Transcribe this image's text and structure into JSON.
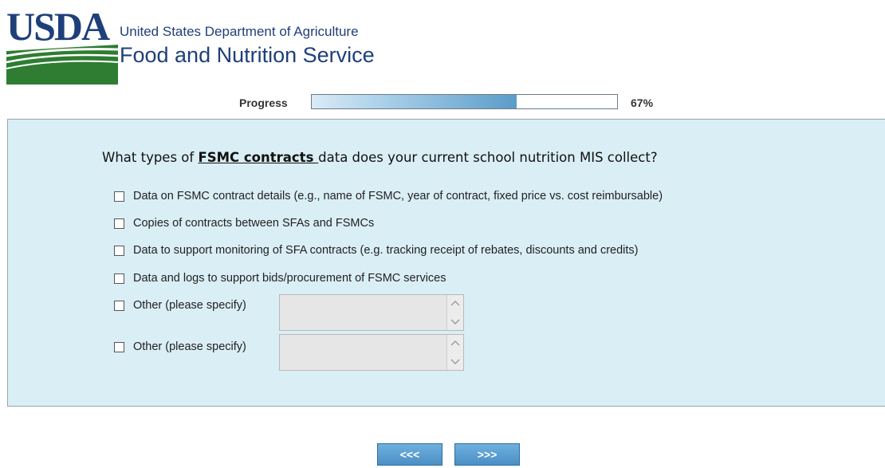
{
  "header": {
    "logo_text": "USDA",
    "agency_line1": "United States Department of Agriculture",
    "agency_line2": "Food and Nutrition Service"
  },
  "progress": {
    "label": "Progress",
    "percent_text": "67%",
    "value": 0.67
  },
  "question": {
    "prefix": "What types of ",
    "keyword": "FSMC contracts ",
    "suffix": "data does your current school nutrition MIS collect?"
  },
  "options": [
    {
      "label": "Data on FSMC contract details (e.g., name of FSMC, year of contract, fixed price vs. cost reimbursable)",
      "checked": false
    },
    {
      "label": "Copies of contracts between SFAs and FSMCs",
      "checked": false
    },
    {
      "label": "Data to support monitoring of SFA contracts (e.g. tracking receipt of rebates, discounts and credits)",
      "checked": false
    },
    {
      "label": "Data and logs to support bids/procurement of FSMC services",
      "checked": false
    },
    {
      "label": "Other (please specify)",
      "checked": false,
      "text_value": ""
    },
    {
      "label": "Other (please specify)",
      "checked": false,
      "text_value": ""
    }
  ],
  "nav": {
    "back_label": "<<<",
    "next_label": ">>>"
  },
  "colors": {
    "brand_blue": "#1f3f7a",
    "brand_green": "#2e7d32",
    "panel_bg": "#daeef5",
    "button_blue": "#4b8fc5"
  }
}
